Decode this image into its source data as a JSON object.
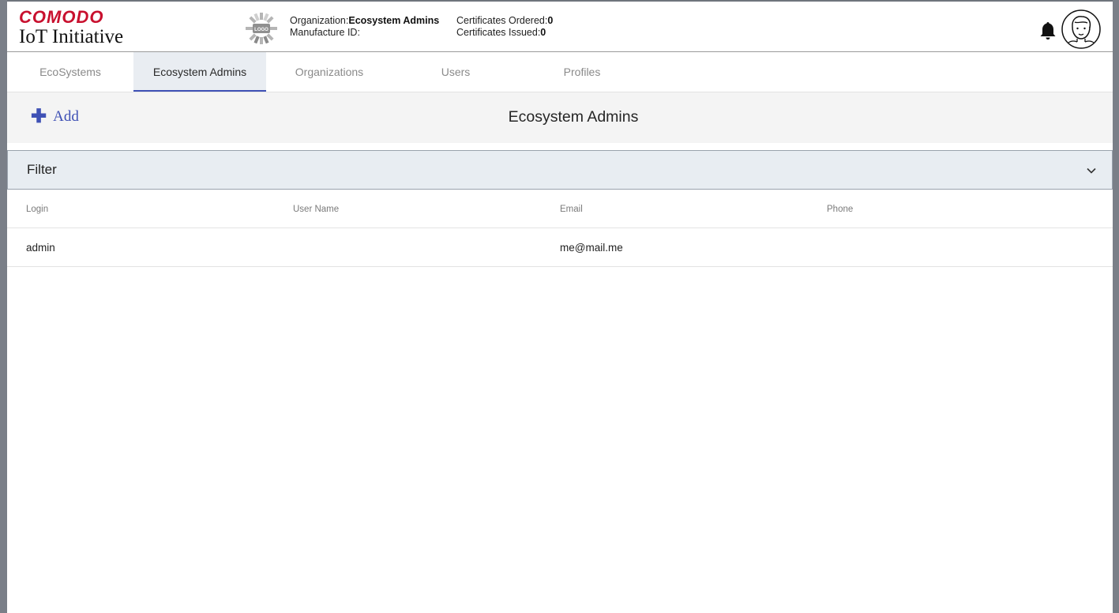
{
  "brand": {
    "name": "COMODO",
    "product": "IoT Initiative",
    "accent": "#c8102e"
  },
  "header": {
    "logo_placeholder_text": "LOGO",
    "organization_label": "Organization:",
    "organization_value": "Ecosystem Admins",
    "manufacture_label": "Manufacture ID:",
    "manufacture_value": "",
    "cert_ordered_label": "Certificates Ordered:",
    "cert_ordered_value": "0",
    "cert_issued_label": "Certificates Issued:",
    "cert_issued_value": "0",
    "icons": [
      "bell-icon",
      "avatar-icon"
    ]
  },
  "tabs": [
    {
      "label": "EcoSystems",
      "active": false
    },
    {
      "label": "Ecosystem Admins",
      "active": true
    },
    {
      "label": "Organizations",
      "active": false
    },
    {
      "label": "Users",
      "active": false
    },
    {
      "label": "Profiles",
      "active": false
    }
  ],
  "toolbar": {
    "add_label": "Add",
    "title": "Ecosystem Admins",
    "primary_color": "#3f51b5"
  },
  "filter": {
    "label": "Filter"
  },
  "table": {
    "columns": [
      "Login",
      "User Name",
      "Email",
      "Phone"
    ],
    "rows": [
      {
        "login": "admin",
        "user_name": "",
        "email": "me@mail.me",
        "phone": ""
      }
    ]
  }
}
